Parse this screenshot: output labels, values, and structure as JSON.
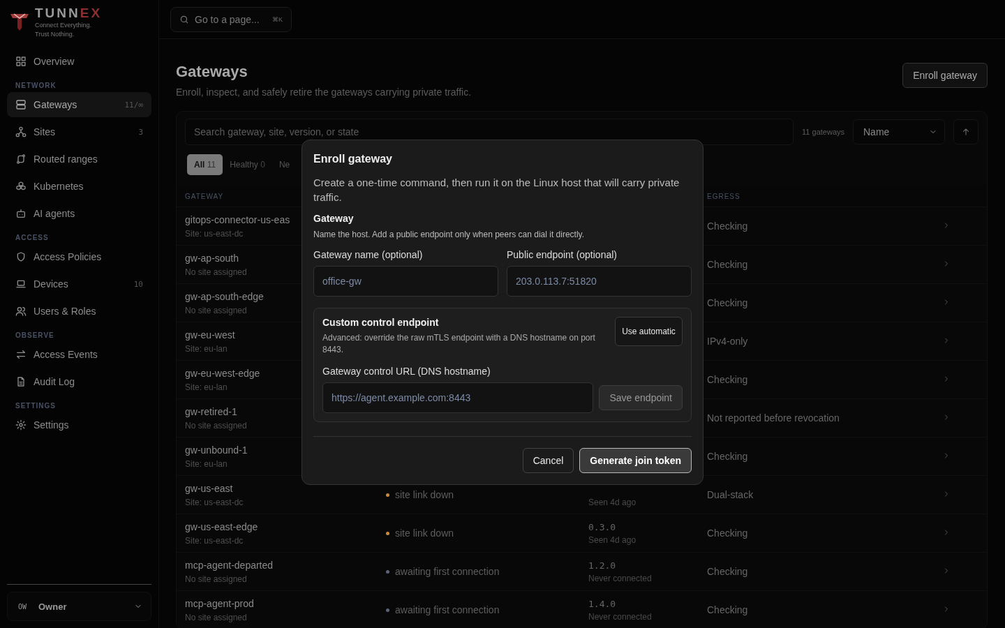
{
  "brand": {
    "name": "TUNNEX",
    "tagline": [
      "Connect Everything.",
      "Trust Nothing."
    ]
  },
  "sidebar": {
    "sections": [
      {
        "items": [
          {
            "label": "Overview",
            "selected": false
          }
        ]
      },
      {
        "heading": "NETWORK",
        "items": [
          {
            "label": "Gateways",
            "count": "11/∞",
            "selected": true
          },
          {
            "label": "Sites",
            "count": "3",
            "selected": false
          },
          {
            "label": "Routed ranges",
            "selected": false
          },
          {
            "label": "Kubernetes",
            "selected": false
          },
          {
            "label": "AI agents",
            "selected": false
          }
        ]
      },
      {
        "heading": "ACCESS",
        "items": [
          {
            "label": "Access Policies",
            "selected": false
          },
          {
            "label": "Devices",
            "count": "10",
            "selected": false
          },
          {
            "label": "Users & Roles",
            "selected": false
          }
        ]
      },
      {
        "heading": "OBSERVE",
        "items": [
          {
            "label": "Access Events",
            "selected": false
          },
          {
            "label": "Audit Log",
            "selected": false
          }
        ]
      },
      {
        "heading": "SETTINGS",
        "items": [
          {
            "label": "Settings",
            "selected": false
          }
        ]
      }
    ],
    "account": {
      "initials": "OW",
      "role": "Owner"
    }
  },
  "topbar": {
    "search_placeholder": "Go to a page...",
    "shortcut": "⌘K"
  },
  "page": {
    "title": "Gateways",
    "subtitle": "Enroll, inspect, and safely retire the gateways carrying private traffic.",
    "primary_button": "Enroll gateway"
  },
  "toolbar": {
    "search_placeholder": "Search gateway, site, version, or state",
    "count": "11 gateways",
    "sort": "Name"
  },
  "filters": [
    {
      "label": "All",
      "count": "11",
      "selected": true
    },
    {
      "label": "Healthy",
      "count": "0",
      "selected": false
    },
    {
      "label": "Ne",
      "selected": false
    }
  ],
  "table": {
    "columns": [
      "GATEWAY",
      "EGRESS"
    ],
    "rows": [
      {
        "name": "gitops-connector-us-eas",
        "site": "Site: us-east-dc",
        "egress": "Checking"
      },
      {
        "name": "gw-ap-south",
        "site": "No site assigned",
        "egress": "Checking"
      },
      {
        "name": "gw-ap-south-edge",
        "site": "No site assigned",
        "egress": "Checking"
      },
      {
        "name": "gw-eu-west",
        "site": "Site: eu-lan",
        "egress": "IPv4-only"
      },
      {
        "name": "gw-eu-west-edge",
        "site": "Site: eu-lan",
        "egress": "Checking"
      },
      {
        "name": "gw-retired-1",
        "site": "No site assigned",
        "egress": "Not reported before revocation"
      },
      {
        "name": "gw-unbound-1",
        "site": "Site: eu-lan",
        "egress": "Checking"
      },
      {
        "name": "gw-us-east",
        "site": "Site: us-east-dc",
        "status": "site link down",
        "color": "#c98a3a",
        "seen": "Seen 4d ago",
        "egress": "Dual-stack"
      },
      {
        "name": "gw-us-east-edge",
        "site": "Site: us-east-dc",
        "status": "site link down",
        "color": "#c98a3a",
        "version": "0.3.0",
        "seen": "Seen 4d ago",
        "egress": "Checking"
      },
      {
        "name": "mcp-agent-departed",
        "site": "No site assigned",
        "status": "awaiting first connection",
        "color": "#5a6378",
        "version": "1.2.0",
        "seen": "Never connected",
        "egress": "Checking"
      },
      {
        "name": "mcp-agent-prod",
        "site": "No site assigned",
        "status": "awaiting first connection",
        "color": "#5a6378",
        "version": "1.4.0",
        "seen": "Never connected",
        "egress": "Checking"
      }
    ]
  },
  "dialog": {
    "title": "Enroll gateway",
    "description": "Create a one-time command, then run it on the Linux host that will carry private traffic.",
    "section": "Gateway",
    "hint": "Name the host. Add a public endpoint only when peers can dial it directly.",
    "fields": [
      {
        "label": "Gateway name (optional)",
        "placeholder": "office-gw"
      },
      {
        "label": "Public endpoint (optional)",
        "placeholder": "203.0.113.7:51820"
      }
    ],
    "custom": {
      "title": "Custom control endpoint",
      "text": "Advanced: override the raw mTLS endpoint with a DNS hostname on port 8443.",
      "toggle_button": "Use automatic",
      "field_label": "Gateway control URL (DNS hostname)",
      "placeholder": "https://agent.example.com:8443",
      "save_button": "Save endpoint",
      "save_disabled": true
    },
    "buttons": [
      "Cancel",
      "Generate join token"
    ]
  }
}
